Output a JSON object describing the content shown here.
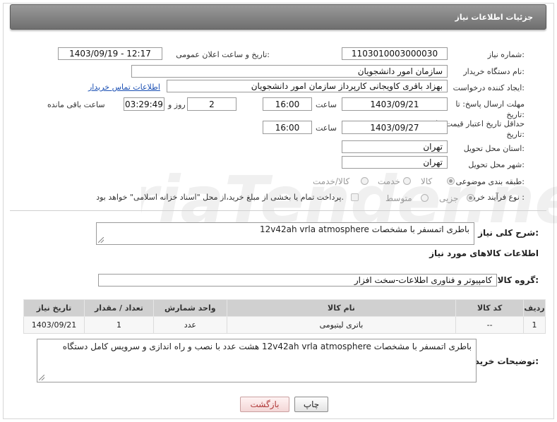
{
  "header": {
    "title": "جزئیات اطلاعات نیاز"
  },
  "need": {
    "number_label": "شماره نیاز:",
    "number": "1103010003000030",
    "announce_label": "تاریخ و ساعت اعلان عمومی:",
    "announce_value": "1403/09/19 - 12:17",
    "buyer_label": "نام دستگاه خریدار:",
    "buyer": "سازمان امور دانشجویان",
    "creator_label": "ایجاد کننده درخواست:",
    "creator": "بهزاد باقری کاویجانی کارپرداز سازمان امور دانشجویان",
    "contact_link": "اطلاعات تماس خریدار",
    "reply_label": "مهلت ارسال پاسخ: تا تاریخ:",
    "reply_date": "1403/09/21",
    "time_label": "ساعت",
    "reply_time": "16:00",
    "days_value": "2",
    "days_label": "روز و",
    "remaining_value": "03:29:49",
    "remaining_label": "ساعت باقی مانده",
    "price_label": "حداقل تاریخ اعتبار قیمت: تا تاریخ:",
    "price_date": "1403/09/27",
    "price_time": "16:00",
    "province_label": "استان محل تحویل:",
    "province": "تهران",
    "city_label": "شهر محل تحویل:",
    "city": "تهران",
    "category_label": "طبقه بندی موضوعی:",
    "category_options": [
      "کالا",
      "خدمت",
      "کالا/خدمت"
    ],
    "process_label": "نوع فرآیند خرید :",
    "process_options": [
      "جزیی",
      "متوسط"
    ],
    "payment_note": "پرداخت تمام یا بخشی از مبلغ خرید،از محل \"اسناد خزانه اسلامی\" خواهد بود."
  },
  "description": {
    "label": "شرح کلی نیاز:",
    "value": "باطری اتمسفر با مشخصات 12v42ah vrla atmosphere"
  },
  "goods_section": {
    "title": "اطلاعات کالاهای مورد نیاز",
    "group_label": "گروه کالا:",
    "group_value": "کامپیوتر و فناوری اطلاعات-سخت افزار"
  },
  "table": {
    "headers": [
      "ردیف",
      "کد کالا",
      "نام کالا",
      "واحد شمارش",
      "تعداد / مقدار",
      "تاریخ نیاز"
    ],
    "rows": [
      [
        "1",
        "--",
        "باتری لیتیومی",
        "عدد",
        "1",
        "1403/09/21"
      ]
    ]
  },
  "buyer_notes": {
    "label": "توضیحات خریدار:",
    "value": "باطری اتمسفر با مشخصات 12v42ah vrla atmosphere هشت عدد با نصب و راه اندازی و سرویس کامل دستگاه"
  },
  "buttons": {
    "print": "چاپ",
    "back": "بازگشت"
  },
  "watermark": {
    "text": "AriaTender.neT"
  }
}
